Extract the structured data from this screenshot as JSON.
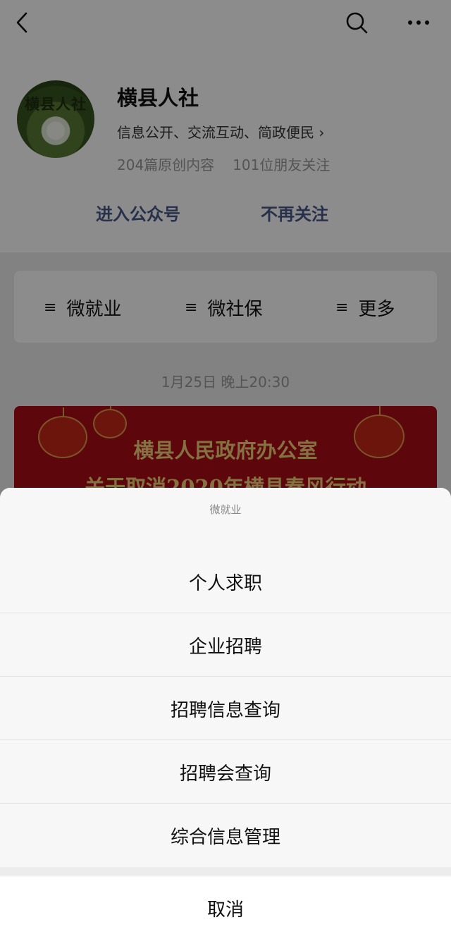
{
  "header": {
    "back_icon": "chevron-left-icon",
    "search_icon": "search-icon",
    "more_icon": "more-horizontal-icon"
  },
  "profile": {
    "avatar_text": "横县人社",
    "name": "横县人社",
    "description": "信息公开、交流互动、简政便民 ›",
    "original_count": "204篇原创内容",
    "followers": "101位朋友关注",
    "enter_label": "进入公众号",
    "unfollow_label": "不再关注"
  },
  "menu": {
    "items": [
      {
        "label": "微就业",
        "icon": "menu-list-icon"
      },
      {
        "label": "微社保",
        "icon": "menu-list-icon"
      },
      {
        "label": "更多",
        "icon": "menu-list-icon"
      }
    ]
  },
  "feed": {
    "timestamp": "1月25日 晚上20:30",
    "article_title_line1": "横县人民政府办公室",
    "article_title_line2": "关于取消2020年横县春风行动"
  },
  "sheet": {
    "title": "微就业",
    "options": [
      "个人求职",
      "企业招聘",
      "招聘信息查询",
      "招聘会查询",
      "综合信息管理"
    ],
    "cancel_label": "取消"
  }
}
